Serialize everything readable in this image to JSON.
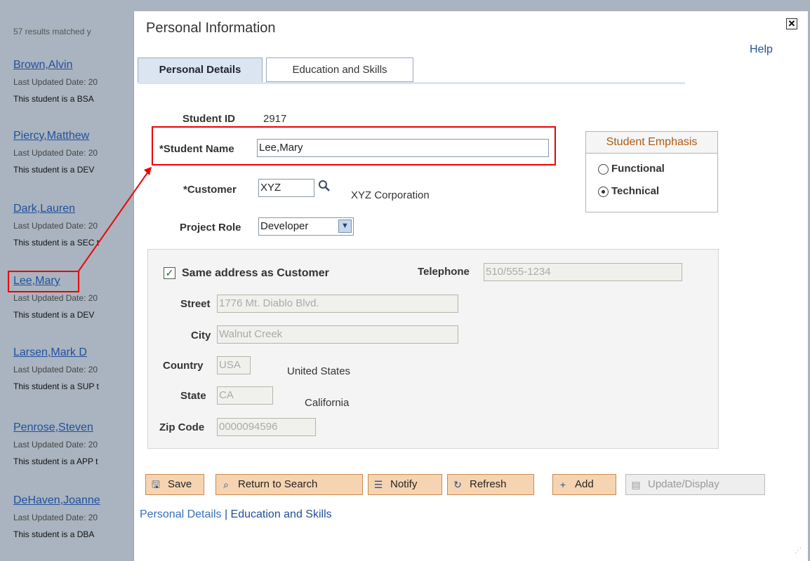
{
  "results": {
    "count_text": "57  results matched y",
    "items": [
      {
        "name": "Brown,Alvin",
        "date": "Last Updated Date: 20",
        "desc": "This student is a BSA"
      },
      {
        "name": "Piercy,Matthew",
        "date": "Last Updated Date: 20",
        "desc": "This student is a DEV"
      },
      {
        "name": "Dark,Lauren",
        "date": "Last Updated Date: 20",
        "desc": "This student is a SEC t"
      },
      {
        "name": "Lee,Mary",
        "date": "Last Updated Date: 20",
        "desc": "This student is a DEV"
      },
      {
        "name": "Larsen,Mark D",
        "date": "Last Updated Date: 20",
        "desc": "This student is a SUP t"
      },
      {
        "name": "Penrose,Steven",
        "date": "Last Updated Date: 20",
        "desc": "This student is a APP t"
      },
      {
        "name": "DeHaven,Joanne",
        "date": "Last Updated Date: 20",
        "desc": "This student is a DBA"
      }
    ]
  },
  "dialog": {
    "title": "Personal Information",
    "close_icon": "close-x-icon",
    "help": "Help",
    "tabs": [
      {
        "label": "Personal Details",
        "active": true
      },
      {
        "label": "Education and Skills",
        "active": false
      }
    ]
  },
  "form": {
    "student_id_label": "Student ID",
    "student_id_value": "2917",
    "student_name_label": "*Student Name",
    "student_name_value": "Lee,Mary",
    "customer_label": "*Customer",
    "customer_value": "XYZ",
    "customer_desc": "XYZ Corporation",
    "project_role_label": "Project Role",
    "project_role_value": "Developer"
  },
  "emphasis": {
    "title": "Student Emphasis",
    "options": [
      {
        "label": "Functional",
        "selected": false
      },
      {
        "label": "Technical",
        "selected": true
      }
    ]
  },
  "address": {
    "same_label": "Same address as Customer",
    "same_checked": true,
    "telephone_label": "Telephone",
    "telephone_value": "510/555-1234",
    "street_label": "Street",
    "street_value": "1776 Mt. Diablo Blvd.",
    "city_label": "City",
    "city_value": "Walnut Creek",
    "country_label": "Country",
    "country_value": "USA",
    "country_desc": "United States",
    "state_label": "State",
    "state_value": "CA",
    "state_desc": "California",
    "zip_label": "Zip Code",
    "zip_value": "0000094596"
  },
  "toolbar": {
    "save": "Save",
    "return": "Return to Search",
    "notify": "Notify",
    "refresh": "Refresh",
    "add": "Add",
    "update": "Update/Display"
  },
  "footer_links": {
    "personal": "Personal Details",
    "separator": " | ",
    "education": "Education and Skills"
  },
  "colors": {
    "highlight": "#e00000",
    "link": "#21509a",
    "button_bg": "#f6d4b1",
    "emphasis_title": "#b05a12"
  }
}
